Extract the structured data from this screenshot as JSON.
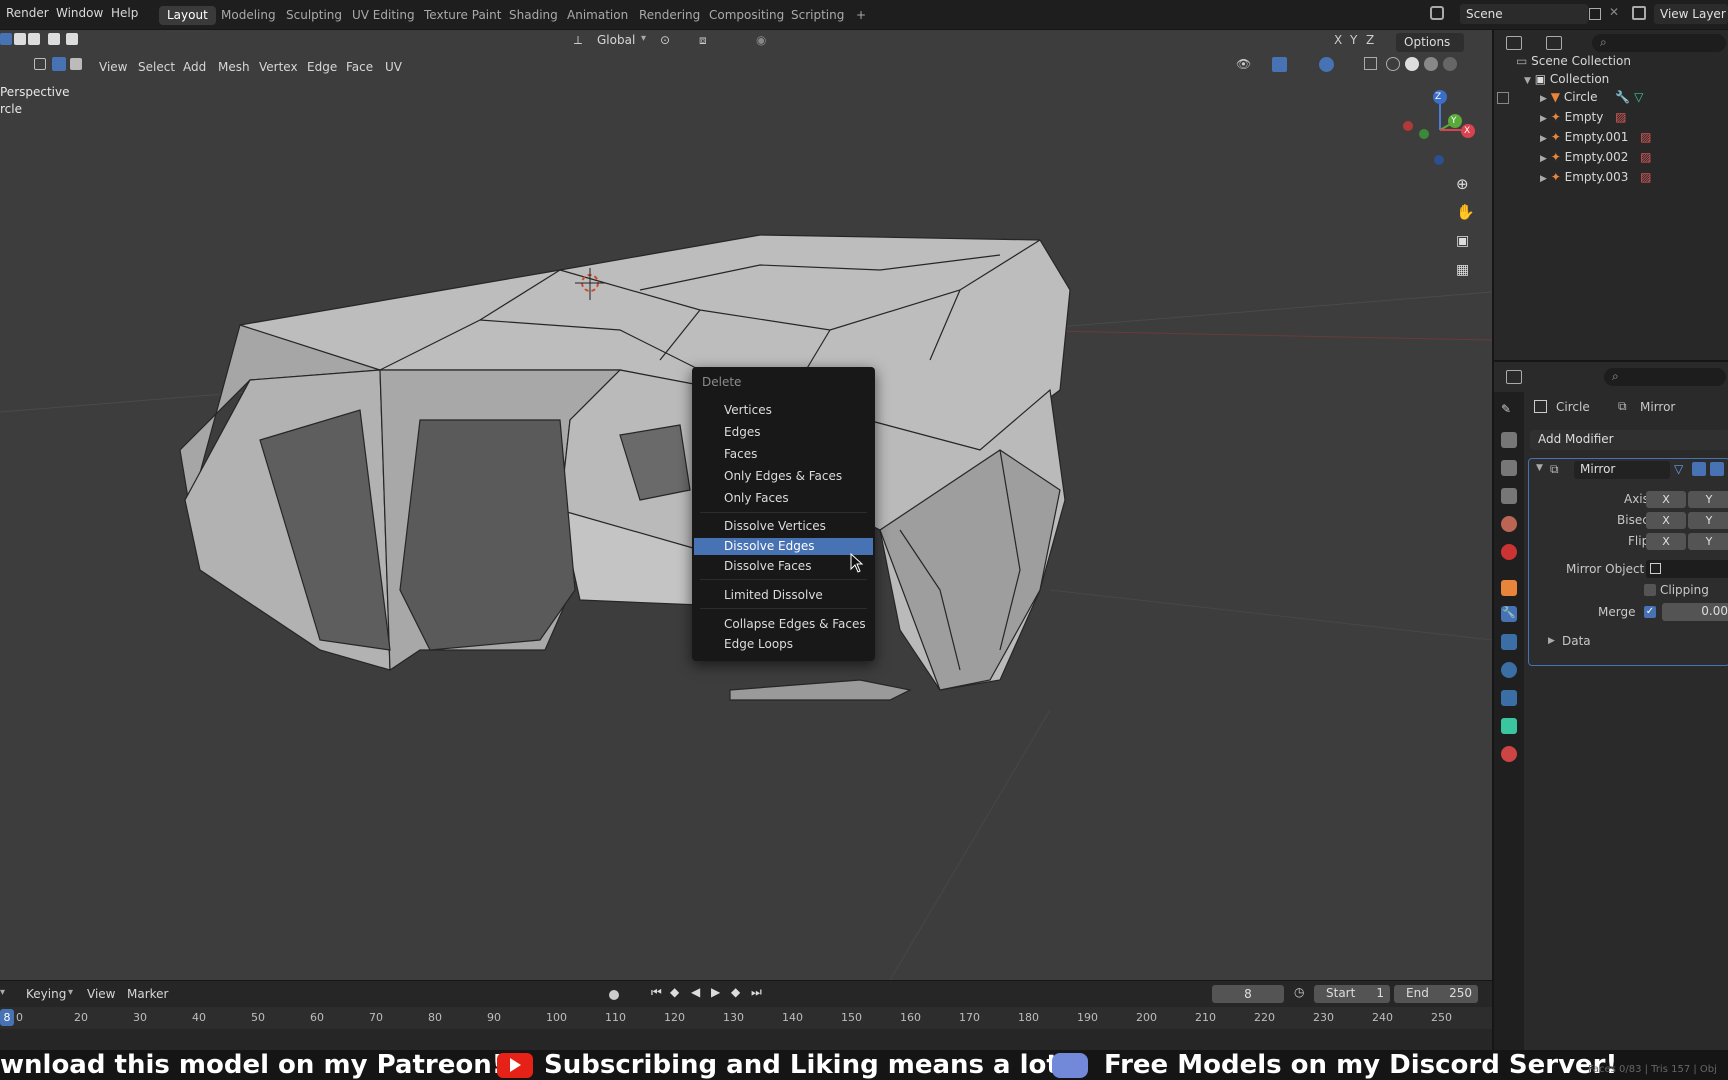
{
  "topbar": {
    "menus": [
      "Render",
      "Window",
      "Help"
    ],
    "workspaces": [
      "Layout",
      "Modeling",
      "Sculpting",
      "UV Editing",
      "Texture Paint",
      "Shading",
      "Animation",
      "Rendering",
      "Compositing",
      "Scripting"
    ],
    "add_tab": "+",
    "scene": "Scene",
    "view_layer": "View Layer"
  },
  "viewport": {
    "header_menus": [
      "View",
      "Select",
      "Add",
      "Mesh",
      "Vertex",
      "Edge",
      "Face",
      "UV"
    ],
    "orientation": "Global",
    "options": "Options",
    "axis_buttons": [
      "X",
      "Y",
      "Z"
    ],
    "overlay_view": "Perspective",
    "overlay_object": "rcle",
    "gizmo_axes": [
      "Z",
      "Y",
      "X"
    ]
  },
  "context_menu": {
    "title": "Delete",
    "groups": [
      [
        "Vertices",
        "Edges",
        "Faces",
        "Only Edges & Faces",
        "Only Faces"
      ],
      [
        "Dissolve Vertices",
        "Dissolve Edges",
        "Dissolve Faces"
      ],
      [
        "Limited Dissolve"
      ],
      [
        "Collapse Edges & Faces",
        "Edge Loops"
      ]
    ],
    "highlighted": "Dissolve Edges"
  },
  "outliner": {
    "root": "Scene Collection",
    "collection": "Collection",
    "items": [
      "Circle",
      "Empty",
      "Empty.001",
      "Empty.002",
      "Empty.003"
    ]
  },
  "properties": {
    "object": "Circle",
    "modifier_tab": "Mirror",
    "add_modifier": "Add Modifier",
    "modifier_name": "Mirror",
    "axis_label": "Axis",
    "bisect_label": "Bisect",
    "flip_label": "Flip",
    "mirror_object_label": "Mirror Object",
    "clipping_label": "Clipping",
    "merge_label": "Merge",
    "merge_value": "0.00",
    "data_label": "Data",
    "x": "X",
    "y": "Y"
  },
  "timeline": {
    "menus": [
      "Keying",
      "View",
      "Marker"
    ],
    "current_frame": "8",
    "start_label": "Start",
    "start": "1",
    "end_label": "End",
    "end": "250",
    "ticks": [
      "0",
      "20",
      "30",
      "40",
      "50",
      "60",
      "70",
      "80",
      "90",
      "100",
      "110",
      "120",
      "130",
      "140",
      "150",
      "160",
      "170",
      "180",
      "190",
      "200",
      "210",
      "220",
      "230",
      "240",
      "250"
    ],
    "playhead": "8"
  },
  "banner": {
    "text1": "wnload this model on my Patreon!",
    "text2": "Subscribing and Liking means a lot!",
    "text3": "Free Models on my Discord Server!",
    "stats": "Faces 0/83 | Tris 157 | Obj"
  },
  "colors": {
    "highlight": "#4772b3",
    "background": "#3d3d3d",
    "panel": "#282828"
  }
}
